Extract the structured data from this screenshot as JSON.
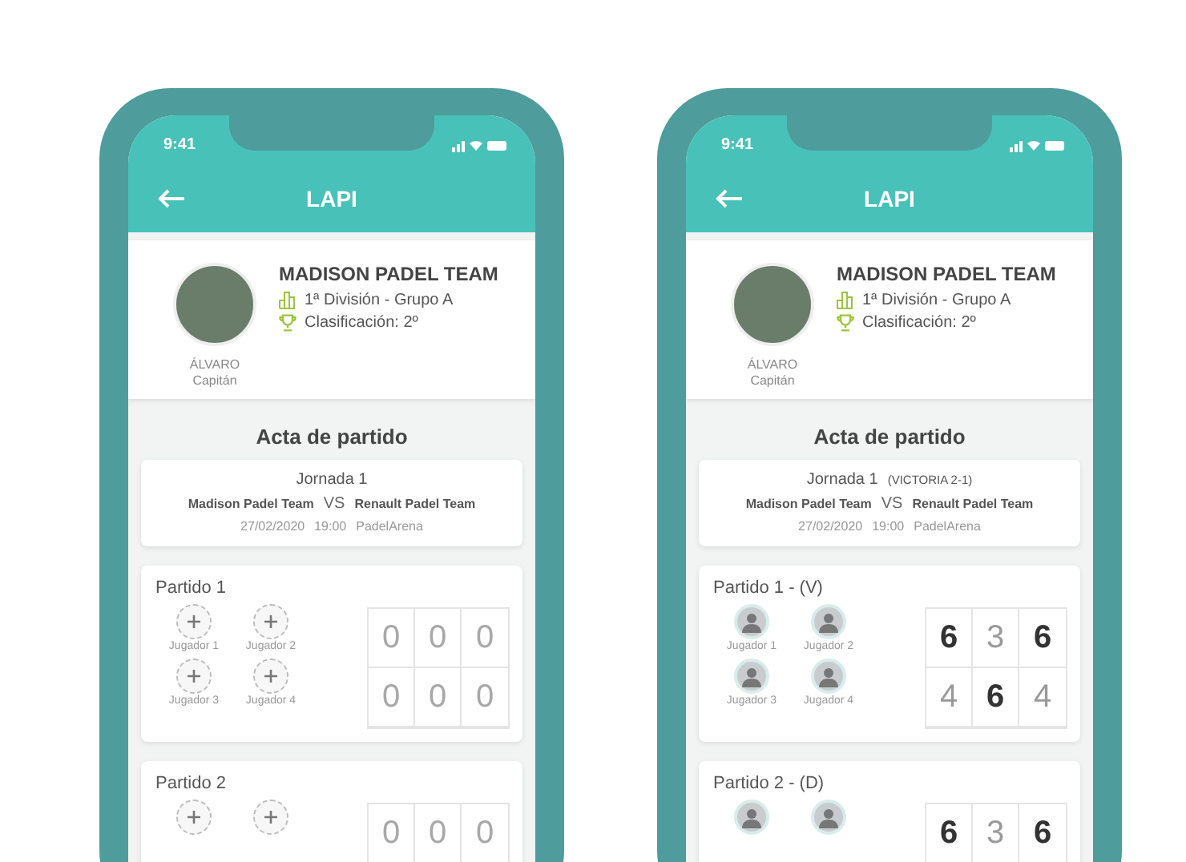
{
  "phones": [
    {
      "status_time": "9:41",
      "title": "LAPI",
      "profile": {
        "name": "ÁLVARO",
        "role": "Capitán",
        "team": "MADISON PADEL TEAM",
        "division": "1ª División - Grupo A",
        "ranking": "Clasificación: 2º"
      },
      "section_title": "Acta de partido",
      "fixture": {
        "round": "Jornada 1",
        "home": "Madison Padel Team",
        "vs": "VS",
        "away": "Renault Padel Team",
        "date": "27/02/2020",
        "time": "19:00",
        "venue": "PadelArena"
      },
      "matches": [
        {
          "title": "Partido 1",
          "played": false,
          "players": [
            {
              "name": "Jugador 1",
              "assigned": false
            },
            {
              "name": "Jugador 2",
              "assigned": false
            },
            {
              "name": "Jugador 3",
              "assigned": false
            },
            {
              "name": "Jugador 4",
              "assigned": false
            }
          ],
          "scores": [
            [
              {
                "value": "0"
              },
              {
                "value": "0"
              },
              {
                "value": "0"
              }
            ],
            [
              {
                "value": "0"
              },
              {
                "value": "0"
              },
              {
                "value": "0"
              }
            ]
          ]
        },
        {
          "title": "Partido 2",
          "played": false,
          "players": [
            {
              "assigned": false
            },
            {
              "assigned": false
            }
          ],
          "scores": [
            [
              {
                "value": "0"
              },
              {
                "value": "0"
              },
              {
                "value": "0"
              }
            ]
          ]
        }
      ]
    },
    {
      "status_time": "9:41",
      "title": "LAPI",
      "profile": {
        "name": "ÁLVARO",
        "role": "Capitán",
        "team": "MADISON PADEL TEAM",
        "division": "1ª División - Grupo A",
        "ranking": "Clasificación: 2º"
      },
      "section_title": "Acta de partido",
      "fixture": {
        "round": "Jornada 1",
        "result": "(VICTORIA 2-1)",
        "home": "Madison Padel Team",
        "vs": "VS",
        "away": "Renault Padel Team",
        "date": "27/02/2020",
        "time": "19:00",
        "venue": "PadelArena"
      },
      "matches": [
        {
          "title": "Partido 1 - (V)",
          "played": true,
          "players": [
            {
              "name": "Jugador 1",
              "assigned": true
            },
            {
              "name": "Jugador 2",
              "assigned": true
            },
            {
              "name": "Jugador 3",
              "assigned": true
            },
            {
              "name": "Jugador 4",
              "assigned": true
            }
          ],
          "scores": [
            [
              {
                "value": "6",
                "won": true
              },
              {
                "value": "3",
                "won": false
              },
              {
                "value": "6",
                "won": true
              }
            ],
            [
              {
                "value": "4",
                "won": false
              },
              {
                "value": "6",
                "won": true
              },
              {
                "value": "4",
                "won": false
              }
            ]
          ]
        },
        {
          "title": "Partido 2 - (D)",
          "played": true,
          "players": [
            {
              "assigned": true
            },
            {
              "assigned": true
            }
          ],
          "scores": [
            [
              {
                "value": "6",
                "won": true
              },
              {
                "value": "3",
                "won": false
              },
              {
                "value": "6",
                "won": true
              }
            ]
          ]
        }
      ]
    }
  ]
}
